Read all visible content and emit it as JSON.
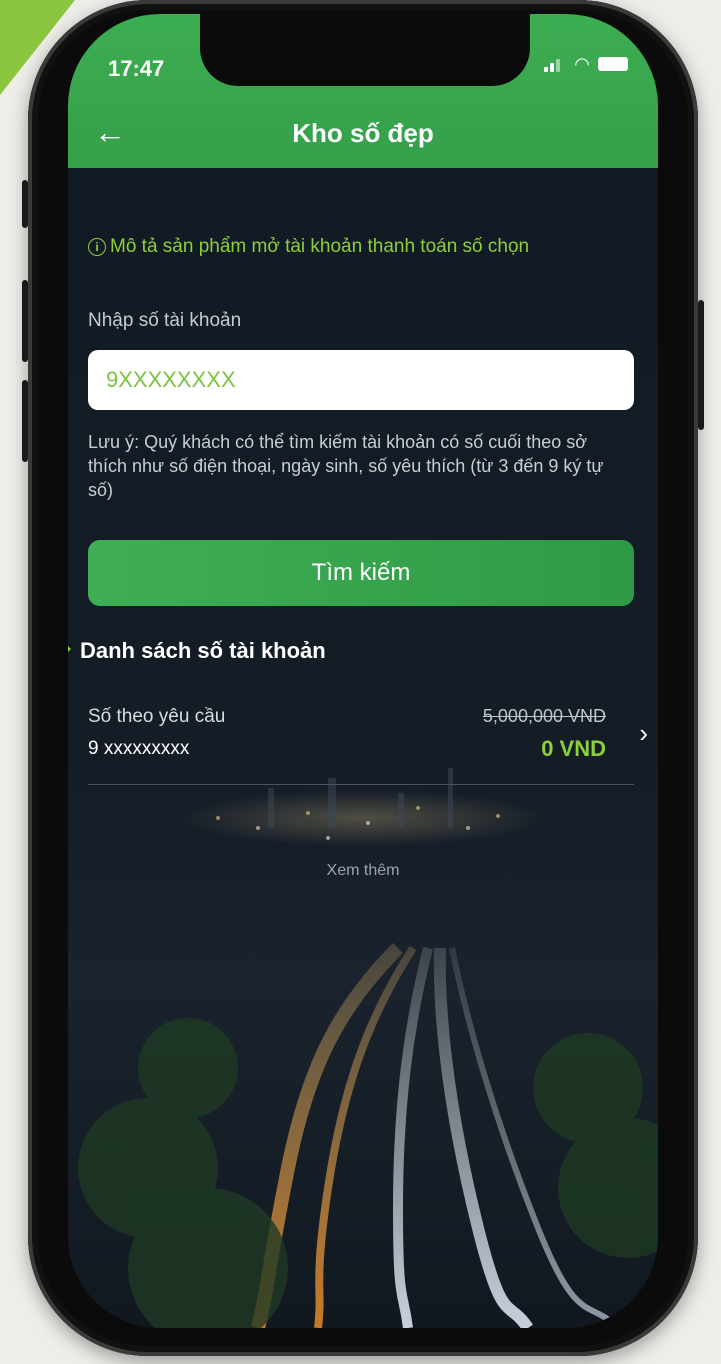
{
  "status_bar": {
    "time": "17:47"
  },
  "header": {
    "title": "Kho số đẹp"
  },
  "info": {
    "text": "Mô tả sản phẩm mở tài khoản thanh toán số chọn"
  },
  "form": {
    "label": "Nhập số tài khoản",
    "input_value": "9XXXXXXXX",
    "note": "Lưu ý: Quý khách có thể tìm kiếm tài khoản có số cuối theo sở thích như số điện thoại, ngày sinh, số yêu thích (từ 3 đến 9 ký tự số)",
    "search_label": "Tìm kiếm"
  },
  "list": {
    "title": "Danh sách số tài khoản",
    "items": [
      {
        "label": "Số theo yêu cầu",
        "number": "9 xxxxxxxxx",
        "old_price": "5,000,000 VND",
        "new_price": "0 VND"
      }
    ],
    "see_more": "Xem thêm"
  },
  "colors": {
    "brand_green": "#3dad52",
    "accent_green": "#8cd03a",
    "corner_tag": "#8cc63f"
  }
}
